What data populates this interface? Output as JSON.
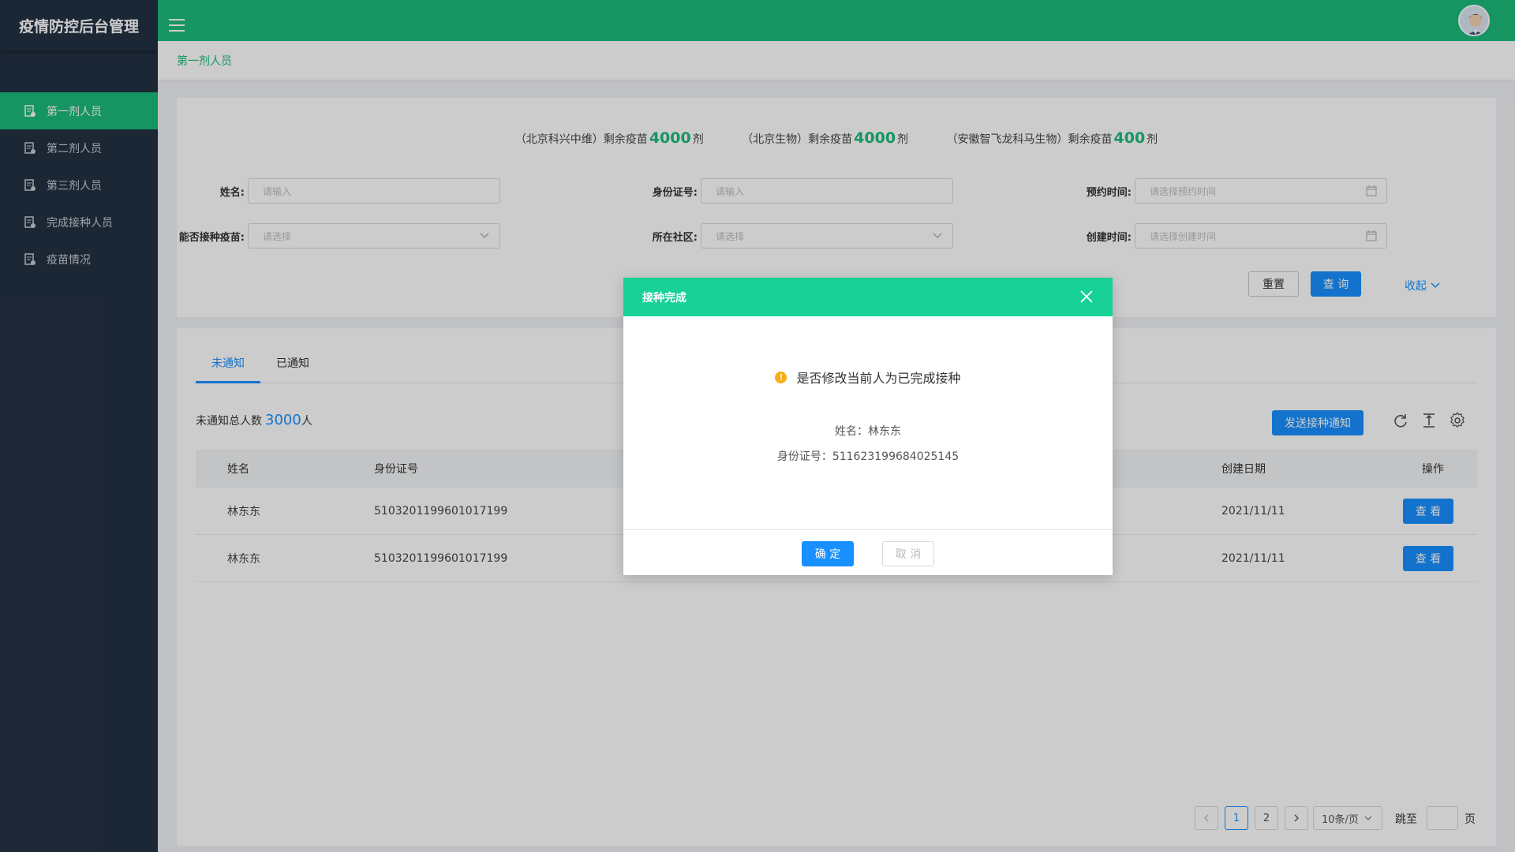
{
  "app": {
    "title": "疫情防控后台管理"
  },
  "sidebar": {
    "items": [
      {
        "label": "第一剂人员",
        "active": true
      },
      {
        "label": "第二剂人员",
        "active": false
      },
      {
        "label": "第三剂人员",
        "active": false
      },
      {
        "label": "完成接种人员",
        "active": false
      },
      {
        "label": "疫苗情况",
        "active": false
      }
    ]
  },
  "breadcrumb": "第一剂人员",
  "stock": [
    {
      "prefix": "（北京科兴中维）剩余疫苗",
      "num": "4000",
      "unit": "剂"
    },
    {
      "prefix": "（北京生物）剩余疫苗",
      "num": "4000",
      "unit": "剂"
    },
    {
      "prefix": "（安徽智飞龙科马生物）剩余疫苗",
      "num": "400",
      "unit": "剂"
    }
  ],
  "filters": {
    "name": {
      "label": "姓名:",
      "placeholder": "请输入"
    },
    "idcard": {
      "label": "身份证号:",
      "placeholder": "请输入"
    },
    "appoint": {
      "label": "预约时间:",
      "placeholder": "请选择预约时间"
    },
    "vaccine": {
      "label": "能否接种疫苗:",
      "placeholder": "请选择"
    },
    "community": {
      "label": "所在社区:",
      "placeholder": "请选择"
    },
    "created": {
      "label": "创建时间:",
      "placeholder": "请选择创建时间"
    },
    "reset": "重置",
    "query": "查 询",
    "collapse": "收起"
  },
  "tabs": [
    "未通知",
    "已通知"
  ],
  "summary": {
    "label": "未通知总人数",
    "num": "3000",
    "unit": "人"
  },
  "send_button": "发送接种通知",
  "table": {
    "headers": {
      "name": "姓名",
      "id": "身份证号",
      "date": "创建日期",
      "op": "操作"
    },
    "rows": [
      {
        "name": "林东东",
        "id": "5103201199601017199",
        "date": "2021/11/11",
        "action": "查 看"
      },
      {
        "name": "林东东",
        "id": "5103201199601017199",
        "date": "2021/11/11",
        "action": "查 看"
      }
    ]
  },
  "pagination": {
    "pages": [
      "1",
      "2"
    ],
    "current": "1",
    "page_size": "10条/页",
    "jump_label": "跳至",
    "page_unit": "页"
  },
  "modal": {
    "title": "接种完成",
    "message": "是否修改当前人为已完成接种",
    "name_line": "姓名：林东东",
    "id_line": "身份证号：511623199684025145",
    "ok": "确 定",
    "cancel": "取 消"
  },
  "colors": {
    "primary_green": "#1cbb7b",
    "modal_green": "#18d196",
    "blue": "#1890ff",
    "sidebar_bg": "#243143"
  }
}
